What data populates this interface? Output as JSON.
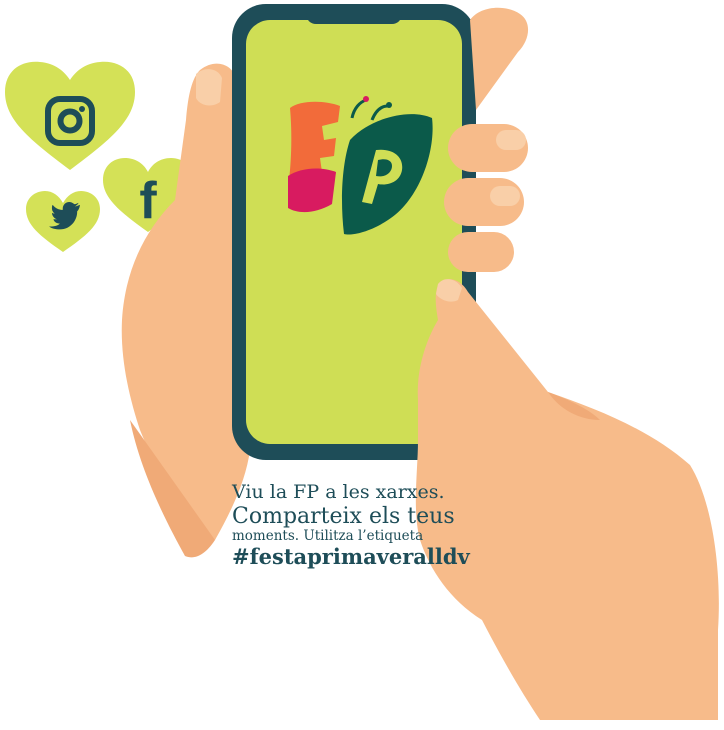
{
  "social": {
    "icons": [
      "instagram-icon",
      "facebook-icon",
      "twitter-icon"
    ],
    "heart_color": "#d4e157",
    "icon_color": "#1e4d58"
  },
  "phone": {
    "screen_color": "#cfde55",
    "frame_color": "#1e4d58",
    "logo": {
      "text": "FP",
      "colors": [
        "#f26b3a",
        "#d81b60",
        "#0b5a4a"
      ]
    }
  },
  "skin_color": "#f7bb8a",
  "message": {
    "line1": "Viu la FP a les xarxes.",
    "line2": "Comparteix els teus",
    "line3": "moments. Utilitza l’etiqueta",
    "hashtag": "#festaprimaveralldv"
  },
  "text_color": "#1e4d58"
}
